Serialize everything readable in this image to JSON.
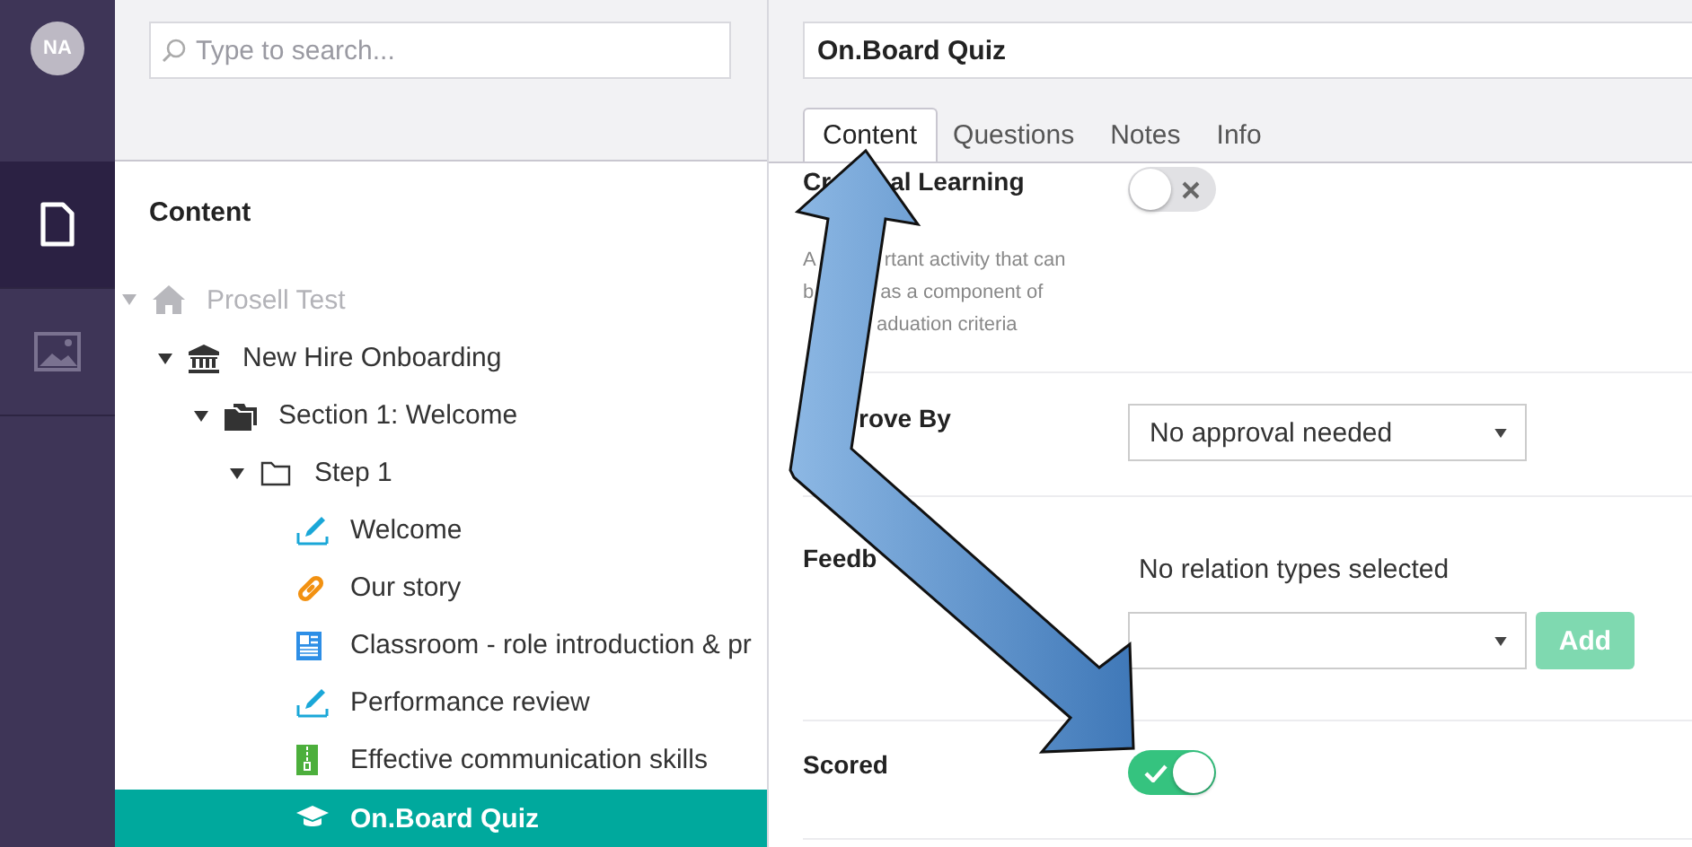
{
  "rail": {
    "avatar": "NA",
    "items": [
      {
        "kind": "document",
        "selected": true
      },
      {
        "kind": "image",
        "selected": false
      }
    ]
  },
  "search": {
    "placeholder": "Type to search..."
  },
  "tree": {
    "heading": "Content",
    "items": [
      {
        "label": "Prosell Test",
        "kind": "home",
        "expanded": true,
        "dimmed": true,
        "selected": false,
        "children": [
          {
            "label": "New Hire Onboarding",
            "kind": "bank",
            "expanded": true,
            "dimmed": false,
            "selected": false,
            "children": [
              {
                "label": "Section 1: Welcome",
                "kind": "section",
                "expanded": true,
                "dimmed": false,
                "selected": false,
                "children": [
                  {
                    "label": "Step 1",
                    "kind": "folder",
                    "expanded": true,
                    "dimmed": false,
                    "selected": false,
                    "children": [
                      {
                        "label": "Welcome",
                        "kind": "edit",
                        "dimmed": false,
                        "selected": false
                      },
                      {
                        "label": "Our story",
                        "kind": "link",
                        "dimmed": false,
                        "selected": false
                      },
                      {
                        "label": "Classroom - role introduction & pr",
                        "kind": "document",
                        "dimmed": false,
                        "selected": false
                      },
                      {
                        "label": "Performance review",
                        "kind": "edit",
                        "dimmed": false,
                        "selected": false
                      },
                      {
                        "label": "Effective communication skills",
                        "kind": "zip",
                        "dimmed": false,
                        "selected": false
                      },
                      {
                        "label": "On.Board Quiz",
                        "kind": "cap",
                        "dimmed": false,
                        "selected": true
                      }
                    ]
                  }
                ]
              }
            ]
          }
        ]
      }
    ]
  },
  "editor": {
    "name": "On.Board Quiz",
    "tabs": [
      {
        "label": "Content",
        "selected": true
      },
      {
        "label": "Questions",
        "selected": false
      },
      {
        "label": "Notes",
        "selected": false
      },
      {
        "label": "Info",
        "selected": false
      }
    ],
    "fields": [
      {
        "kind": "toggle",
        "label": [
          "Cr",
          "al Learning"
        ],
        "description": [
          [
            "A",
            "rtant activity that can"
          ],
          [
            "b",
            "as a component of"
          ],
          [
            "aduation criteria"
          ]
        ],
        "on": false
      },
      {
        "kind": "select",
        "label": [
          "rove By"
        ],
        "value": "No approval needed"
      },
      {
        "kind": "relations",
        "label": [
          "Feedb"
        ],
        "note": "No relation types selected",
        "button": {
          "label": "Add",
          "disabled": true
        }
      },
      {
        "kind": "toggle",
        "label": [
          "Scored"
        ],
        "on": true
      }
    ]
  }
}
